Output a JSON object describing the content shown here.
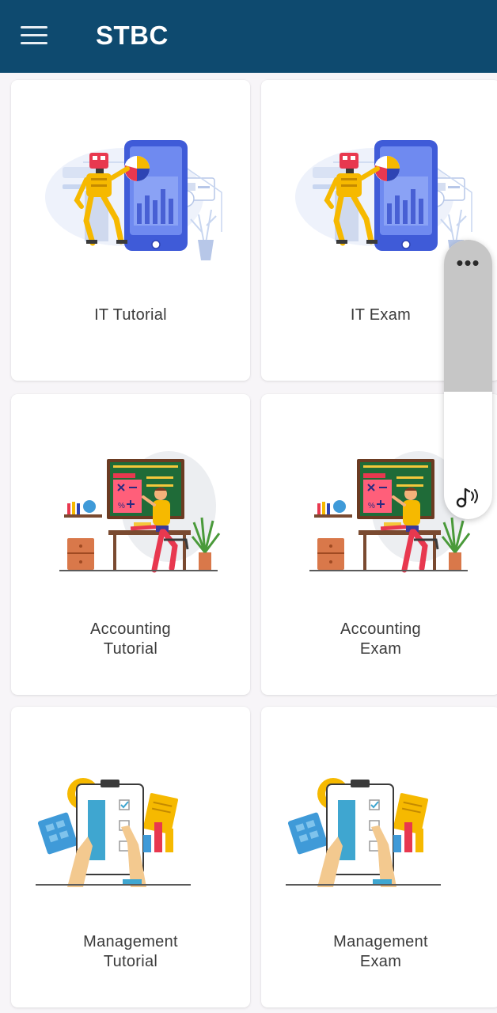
{
  "app": {
    "title": "STBC",
    "menu_icon": "menu-icon"
  },
  "cards": [
    {
      "label": "IT Tutorial",
      "illustration": "robot-phone-illustration"
    },
    {
      "label": "IT Exam",
      "illustration": "robot-phone-illustration"
    },
    {
      "label": "Accounting\nTutorial",
      "illustration": "accounting-classroom-illustration"
    },
    {
      "label": "Accounting\nExam",
      "illustration": "accounting-classroom-illustration"
    },
    {
      "label": "Management\nTutorial",
      "illustration": "management-checklist-illustration"
    },
    {
      "label": "Management\nExam",
      "illustration": "management-checklist-illustration"
    }
  ],
  "floating_panel": {
    "dots": "•••",
    "icon": "sound-wave-icon"
  },
  "colors": {
    "appbar": "#0e4a6f",
    "background": "#f7f5f8",
    "card": "#ffffff",
    "text": "#3b3b3b"
  }
}
